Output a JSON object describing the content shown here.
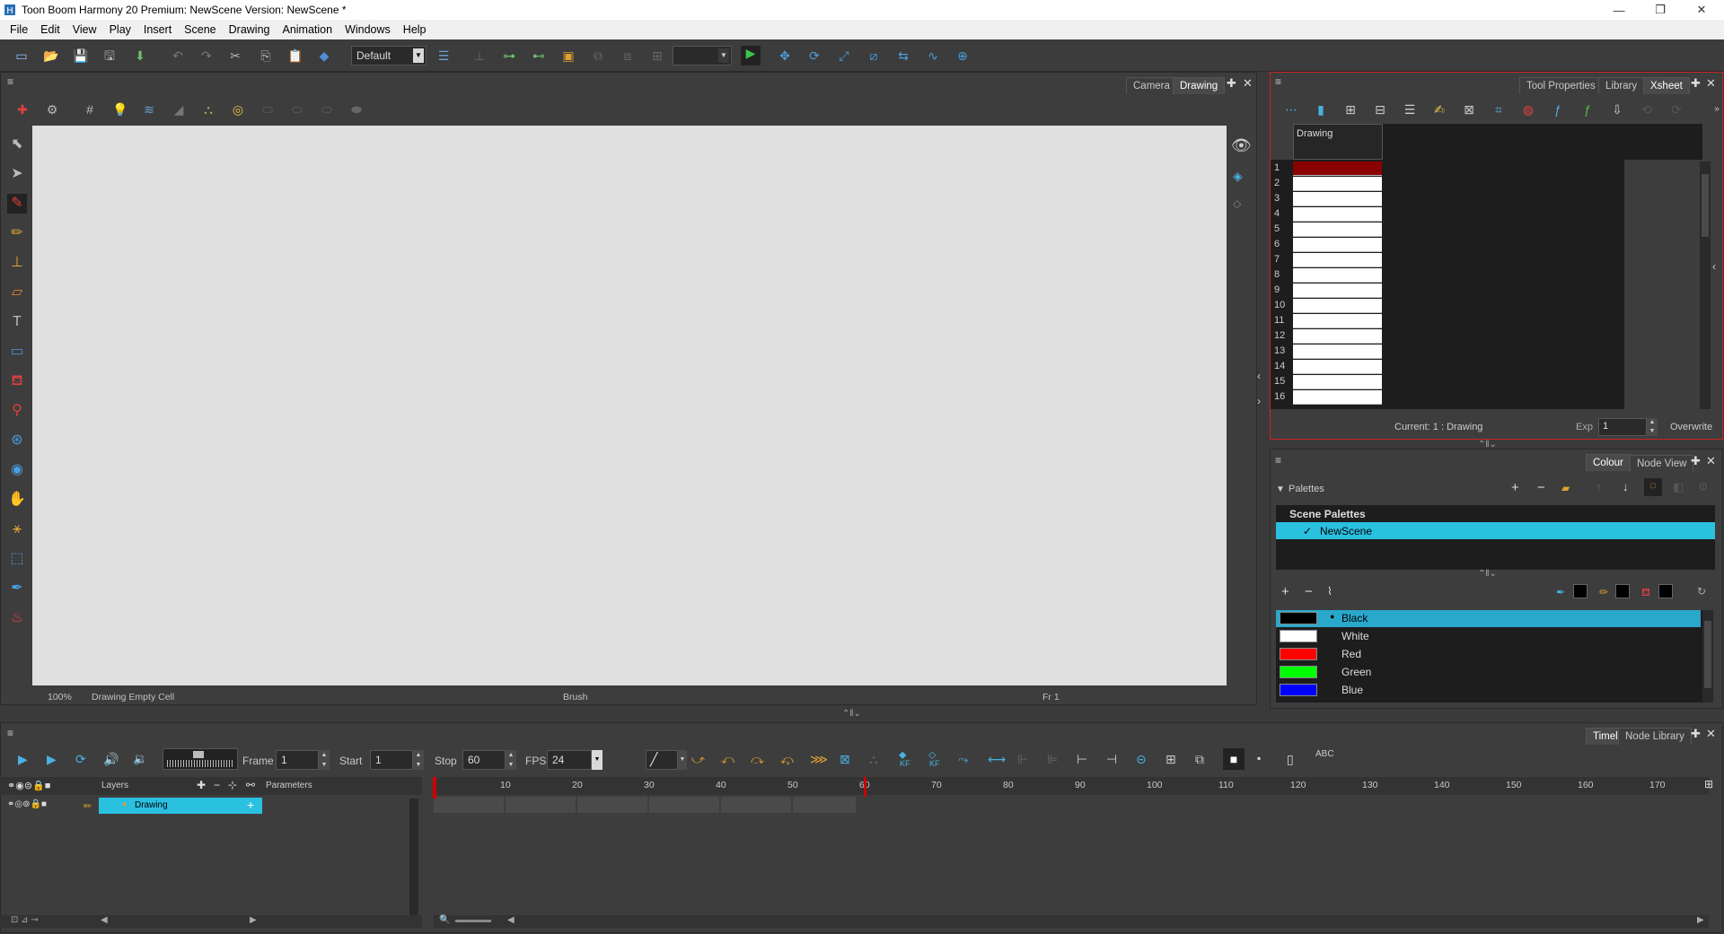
{
  "window": {
    "title": "Toon Boom Harmony 20 Premium: NewScene Version: NewScene *"
  },
  "menu": [
    "File",
    "Edit",
    "View",
    "Play",
    "Insert",
    "Scene",
    "Drawing",
    "Animation",
    "Windows",
    "Help"
  ],
  "toolbar": {
    "workspace_value": "Default"
  },
  "drawing_view": {
    "tabs": [
      "Camera",
      "Drawing"
    ],
    "active_tab": "Drawing",
    "status": {
      "zoom": "100%",
      "cell_info": "Drawing Empty Cell",
      "tool": "Brush",
      "frame": "Fr 1"
    }
  },
  "xsheet": {
    "tabs": [
      "Tool Properties",
      "Library",
      "Xsheet"
    ],
    "active_tab": "Xsheet",
    "column_header": "Drawing",
    "frames": [
      "1",
      "2",
      "3",
      "4",
      "5",
      "6",
      "7",
      "8",
      "9",
      "10",
      "11",
      "12",
      "13",
      "14",
      "15",
      "16"
    ],
    "current_label": "Current: 1 : Drawing",
    "exp_label": "Exp",
    "exp_value": "1",
    "overwrite_label": "Overwrite"
  },
  "colour": {
    "tabs": [
      "Colour",
      "Node View"
    ],
    "active_tab": "Colour",
    "palettes_label": "Palettes",
    "scene_palettes_label": "Scene Palettes",
    "palette_item": "NewScene",
    "palette_check": "✓",
    "swatches": [
      {
        "name": "Black",
        "color": "#000000"
      },
      {
        "name": "White",
        "color": "#ffffff"
      },
      {
        "name": "Red",
        "color": "#ff0000"
      },
      {
        "name": "Green",
        "color": "#00ff00"
      },
      {
        "name": "Blue",
        "color": "#0000ff"
      }
    ]
  },
  "timeline": {
    "tabs": [
      "Timeline",
      "Node Library"
    ],
    "active_tab": "Timeline",
    "frame_label": "Frame",
    "frame_value": "1",
    "start_label": "Start",
    "start_value": "1",
    "stop_label": "Stop",
    "stop_value": "60",
    "fps_label": "FPS",
    "fps_value": "24",
    "kf_label": "KF",
    "abc_label": "ABC",
    "layers_label": "Layers",
    "parameters_label": "Parameters",
    "layer_name": "Drawing",
    "ruler": [
      "10",
      "20",
      "30",
      "40",
      "50",
      "60",
      "70",
      "80",
      "90",
      "100",
      "110",
      "120",
      "130",
      "140",
      "150",
      "160",
      "170"
    ]
  },
  "colors": {
    "accent": "#2aa8cc",
    "playhead": "#cc0000",
    "canvas": "#e0e0e0"
  }
}
